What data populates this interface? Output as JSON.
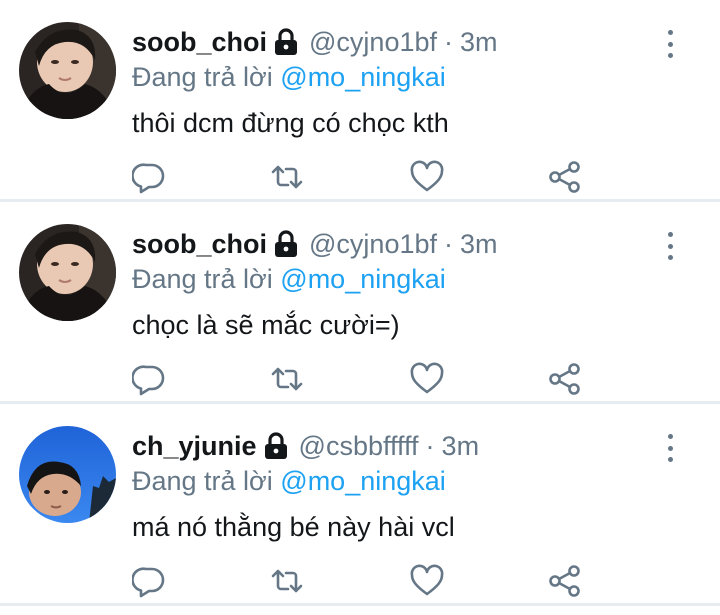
{
  "tweets": [
    {
      "display_name": "soob_choi",
      "handle": "@cyjno1bf",
      "separator": "·",
      "time": "3m",
      "reply_prefix": "Đang trả lời",
      "reply_to": "@mo_ningkai",
      "text": "thôi dcm đừng có chọc kth",
      "avatar_icon": "dark-profile-photo"
    },
    {
      "display_name": "soob_choi",
      "handle": "@cyjno1bf",
      "separator": "·",
      "time": "3m",
      "reply_prefix": "Đang trả lời",
      "reply_to": "@mo_ningkai",
      "text": "chọc là sẽ mắc cười=)",
      "avatar_icon": "dark-profile-photo"
    },
    {
      "display_name": "ch_yjunie",
      "handle": "@csbbfffff",
      "separator": "·",
      "time": "3m",
      "reply_prefix": "Đang trả lời",
      "reply_to": "@mo_ningkai",
      "text": "má nó thằng bé này hài vcl",
      "avatar_icon": "blue-sky-profile-photo"
    }
  ],
  "icons": {
    "lock": "lock-icon",
    "more": "more-vertical-icon",
    "reply": "reply-icon",
    "retweet": "retweet-icon",
    "like": "like-icon",
    "share": "share-icon"
  },
  "colors": {
    "text_primary": "#14171a",
    "text_secondary": "#657786",
    "mention": "#1da1f2",
    "divider": "#e6ecf0"
  }
}
